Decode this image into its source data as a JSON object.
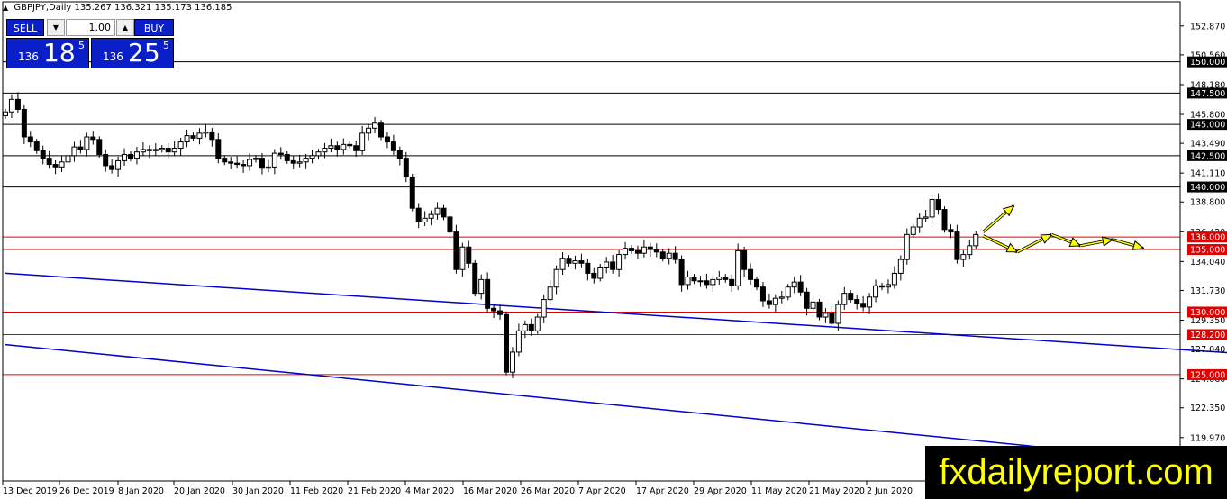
{
  "header": {
    "symbol_line": "GBPJPY,Daily  135.267 136.321 135.173 136.185"
  },
  "trade_panel": {
    "sell_label": "SELL",
    "buy_label": "BUY",
    "lot": "1.00",
    "sell_price_big": "136",
    "sell_price_large": "18",
    "sell_price_sup": "5",
    "buy_price_big": "136",
    "buy_price_large": "25",
    "buy_price_sup": "5",
    "button_color": "#0a1fc8"
  },
  "watermark": {
    "text": "fxdailyreport.com",
    "color": "#ffff00"
  },
  "chart_data": {
    "type": "candlestick",
    "symbol": "GBPJPY",
    "timeframe": "Daily",
    "ylim": [
      116.5,
      154.8
    ],
    "price_ticks": [
      "152.870",
      "150.560",
      "148.180",
      "145.800",
      "143.490",
      "141.110",
      "138.800",
      "136.420",
      "134.040",
      "131.730",
      "129.350",
      "127.040",
      "124.660",
      "122.350",
      "119.970"
    ],
    "x_labels": [
      "13 Dec 2019",
      "26 Dec 2019",
      "8 Jan 2020",
      "20 Jan 2020",
      "30 Jan 2020",
      "11 Feb 2020",
      "21 Feb 2020",
      "4 Mar 2020",
      "16 Mar 2020",
      "26 Mar 2020",
      "7 Apr 2020",
      "17 Apr 2020",
      "29 Apr 2020",
      "11 May 2020",
      "21 May 2020",
      "2 Jun 2020"
    ],
    "horizontal_levels": [
      {
        "price": 150.0,
        "label": "150.000",
        "color": "#000000"
      },
      {
        "price": 147.5,
        "label": "147.500",
        "color": "#000000"
      },
      {
        "price": 145.0,
        "label": "145.000",
        "color": "#000000"
      },
      {
        "price": 142.5,
        "label": "142.500",
        "color": "#000000"
      },
      {
        "price": 140.0,
        "label": "140.000",
        "color": "#000000"
      },
      {
        "price": 136.0,
        "label": "136.000",
        "color": "#e00000"
      },
      {
        "price": 135.0,
        "label": "135.000",
        "color": "#e00000"
      },
      {
        "price": 130.0,
        "label": "130.000",
        "color": "#e00000"
      },
      {
        "price": 128.2,
        "label": "128.200",
        "color": "#e00000"
      },
      {
        "price": 125.0,
        "label": "125.000",
        "color": "#e00000"
      }
    ],
    "trendlines": [
      {
        "color": "#0000cc",
        "from": {
          "bar": 0,
          "price": 133.1
        },
        "to": {
          "bar": 200,
          "price": 126.6
        }
      },
      {
        "color": "#0000cc",
        "from": {
          "bar": 0,
          "price": 127.4
        },
        "to": {
          "bar": 200,
          "price": 117.5
        }
      }
    ],
    "forecast_arrows": {
      "color": "#ffff00",
      "up_arrow": [
        [
          136.4,
          138.5
        ]
      ],
      "zigzag_prices": [
        136.1,
        134.8,
        136.2,
        135.3,
        135.8,
        135.1
      ]
    },
    "closes": [
      146.0,
      147.0,
      146.2,
      144.0,
      143.6,
      142.9,
      142.3,
      141.8,
      141.6,
      142.0,
      142.5,
      143.2,
      143.0,
      144.0,
      143.8,
      142.6,
      141.7,
      141.4,
      142.1,
      142.6,
      142.3,
      142.8,
      143.0,
      142.9,
      143.0,
      143.1,
      142.8,
      143.1,
      143.6,
      144.1,
      143.9,
      144.3,
      144.4,
      143.8,
      142.3,
      142.0,
      141.9,
      141.8,
      141.7,
      142.2,
      142.3,
      141.5,
      141.6,
      142.7,
      142.6,
      142.1,
      141.9,
      142.0,
      142.3,
      142.5,
      142.8,
      143.1,
      143.3,
      143.0,
      143.4,
      143.3,
      142.9,
      144.3,
      144.7,
      145.1,
      144.0,
      143.6,
      142.9,
      142.3,
      140.8,
      138.3,
      137.2,
      137.5,
      137.8,
      138.3,
      137.6,
      136.4,
      133.4,
      135.2,
      133.9,
      131.5,
      132.6,
      130.3,
      130.1,
      129.8,
      125.2,
      126.8,
      128.5,
      129.0,
      128.5,
      129.6,
      131.0,
      132.0,
      133.4,
      134.3,
      133.9,
      134.1,
      133.9,
      133.1,
      132.7,
      133.6,
      134.0,
      133.4,
      134.6,
      135.1,
      134.9,
      134.7,
      135.2,
      135.0,
      134.8,
      134.3,
      134.7,
      134.2,
      132.2,
      132.8,
      132.5,
      132.5,
      132.2,
      132.6,
      132.8,
      132.6,
      132.1,
      134.9,
      133.4,
      132.6,
      132.0,
      130.9,
      130.6,
      131.1,
      131.2,
      132.0,
      132.4,
      131.6,
      130.3,
      130.8,
      129.6,
      129.9,
      129.1,
      130.6,
      131.5,
      131.0,
      130.7,
      130.4,
      131.2,
      132.1,
      132.0,
      132.2,
      133.1,
      134.2,
      136.2,
      136.8,
      137.5,
      137.6,
      139.0,
      138.2,
      136.6,
      136.4,
      134.2,
      134.6,
      135.3,
      136.2
    ],
    "palette": {
      "bull_fill": "#ffffff",
      "bear_fill": "#000000",
      "wick": "#000000",
      "grid_bg": "#ffffff"
    }
  }
}
